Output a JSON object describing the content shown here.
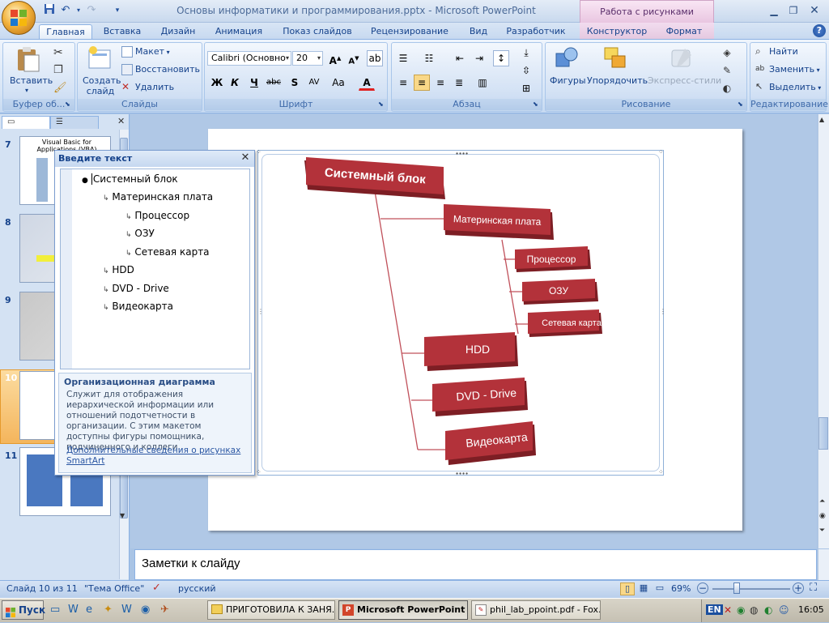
{
  "app": {
    "window_title": "Основы информатики и программирования.pptx - Microsoft PowerPoint",
    "context_title": "Работа с рисунками SmartArt"
  },
  "tabs": [
    "Главная",
    "Вставка",
    "Дизайн",
    "Анимация",
    "Показ слайдов",
    "Рецензирование",
    "Вид",
    "Разработчик"
  ],
  "context_tabs": [
    "Конструктор",
    "Формат"
  ],
  "ribbon": {
    "clipboard": {
      "paste": "Вставить",
      "label": "Буфер об..."
    },
    "slides": {
      "new_slide": "Создать слайд",
      "layout": "Макет",
      "reset": "Восстановить",
      "delete": "Удалить",
      "label": "Слайды"
    },
    "font": {
      "name": "Calibri (Основно",
      "size": "20",
      "label": "Шрифт"
    },
    "paragraph": {
      "label": "Абзац"
    },
    "drawing": {
      "shapes": "Фигуры",
      "arrange": "Упорядочить",
      "quick_styles": "Экспресс-стили",
      "label": "Рисование"
    },
    "editing": {
      "find": "Найти",
      "replace": "Заменить",
      "select": "Выделить",
      "label": "Редактирование"
    }
  },
  "thumbnails": [
    {
      "num": "7",
      "title": "Visual Basic for Applications (VBA)"
    },
    {
      "num": "8",
      "title": ""
    },
    {
      "num": "9",
      "title": ""
    },
    {
      "num": "10",
      "title": ""
    },
    {
      "num": "11",
      "title": ""
    }
  ],
  "text_pane": {
    "title": "Введите текст",
    "items": [
      {
        "level": 0,
        "text": "Системный блок"
      },
      {
        "level": 1,
        "text": "Материнская плата"
      },
      {
        "level": 2,
        "text": "Процессор"
      },
      {
        "level": 2,
        "text": "ОЗУ"
      },
      {
        "level": 2,
        "text": "Сетевая карта"
      },
      {
        "level": 1,
        "text": "HDD"
      },
      {
        "level": 1,
        "text": "DVD - Drive"
      },
      {
        "level": 1,
        "text": "Видеокарта"
      }
    ],
    "desc_title": "Организационная диаграмма",
    "desc_body": "Служит для отображения иерархической информации или отношений подотчетности в организации. С этим макетом доступны фигуры помощника, подчиненного и коллеги.",
    "desc_link": "Дополнительные сведения о рисунках SmartArt"
  },
  "diagram": {
    "root": "Системный блок",
    "mb": "Материнская плата",
    "cpu": "Процессор",
    "ram": "ОЗУ",
    "nic": "Сетевая карта",
    "hdd": "HDD",
    "dvd": "DVD - Drive",
    "gpu": "Видеокарта",
    "box_color": "#b3323a",
    "line_color": "#c0505a"
  },
  "notes_placeholder": "Заметки к слайду",
  "status": {
    "slide": "Слайд 10 из 11",
    "theme": "\"Тема Office\"",
    "lang": "русский",
    "zoom": "69%"
  },
  "taskbar": {
    "start": "Пуск",
    "items": [
      "ПРИГОТОВИЛА К ЗАНЯ...",
      "Microsoft PowerPoint ...",
      "phil_lab_ppoint.pdf - Fox..."
    ],
    "lang": "EN",
    "time": "16:05"
  }
}
